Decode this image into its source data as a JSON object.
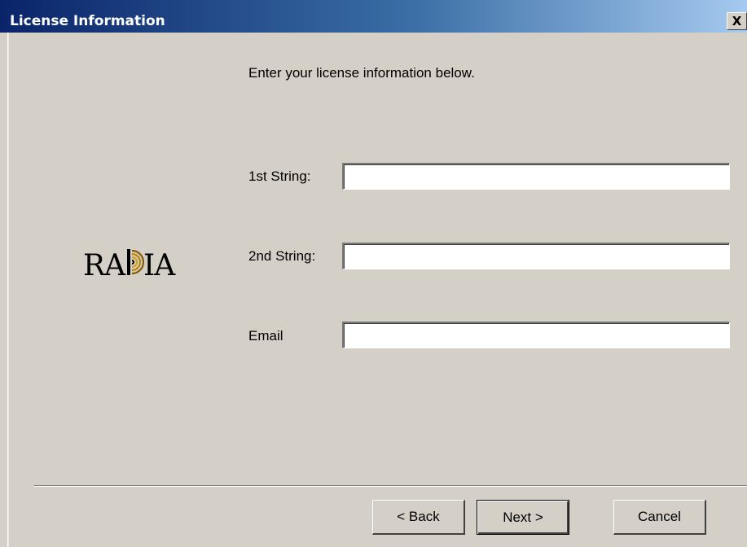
{
  "window": {
    "title": "License Information",
    "close_glyph": "X"
  },
  "logo": {
    "text": "RADIA",
    "icon": "radia-logo"
  },
  "instructions": "Enter your license information below.",
  "fields": [
    {
      "label": "1st String:",
      "value": "",
      "placeholder": ""
    },
    {
      "label": "2nd String:",
      "value": "",
      "placeholder": ""
    },
    {
      "label": "Email",
      "value": "",
      "placeholder": ""
    }
  ],
  "buttons": {
    "back_label": "< Back",
    "next_label": "Next >",
    "cancel_label": "Cancel"
  },
  "colors": {
    "dialog_face": "#d4d0c8",
    "titlebar_start": "#0a246a",
    "titlebar_end": "#a6caf0",
    "logo_accent": "#b8860b"
  }
}
